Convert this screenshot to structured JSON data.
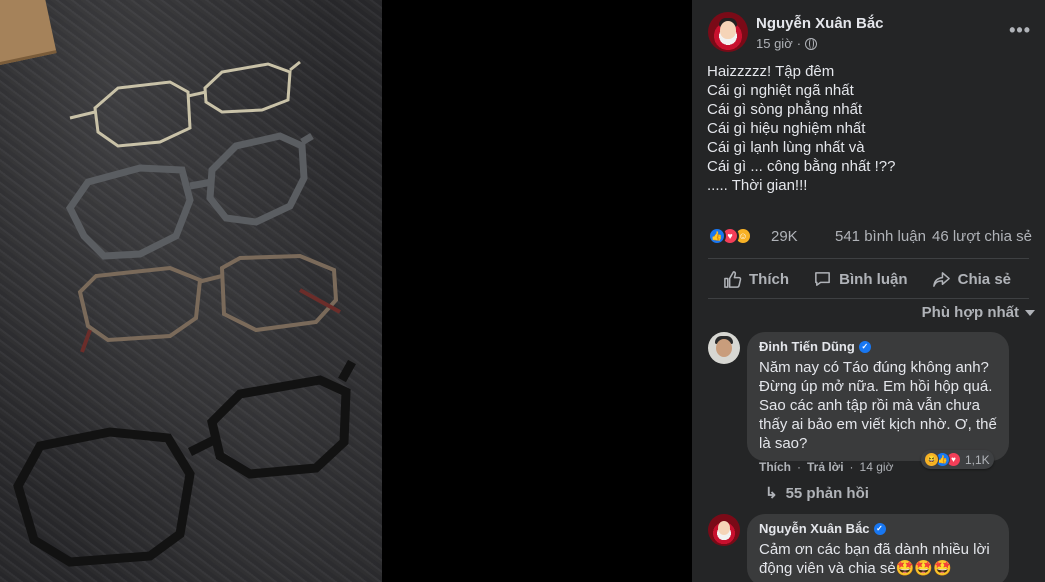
{
  "post": {
    "author": "Nguyễn Xuân Bắc",
    "time": "15 giờ",
    "privacy_icon": "globe-icon",
    "text": "Haizzzzz! Tập đêm\nCái gì nghiệt ngã nhất\nCái gì sòng phẳng nhất\nCái gì hiệu nghiệm nhất\nCái gì lạnh lùng nhất và\nCái gì ... công bằng nhất !??\n..... Thời gian!!!",
    "reaction_count": "29K",
    "comment_count": "541 bình luận",
    "share_count": "46 lượt chia sẻ"
  },
  "actions": {
    "like": "Thích",
    "comment": "Bình luận",
    "share": "Chia sẻ"
  },
  "sort_label": "Phù hợp nhất",
  "comments": [
    {
      "author": "Đinh Tiến Dũng",
      "text": "Năm nay có Táo đúng không anh?\nĐừng úp mở nữa. Em hồi hộp quá.\nSao các anh tập rồi mà vẫn chưa\nthấy ai bảo em viết kịch nhờ. Ơ, thế\nlà sao?",
      "reactions": "1,1K",
      "like": "Thích",
      "reply": "Trả lời",
      "time": "14 giờ",
      "replies": "55 phản hồi"
    },
    {
      "author": "Nguyễn Xuân Bắc",
      "text": "Cảm ơn các bạn đã dành nhiều lời\nđộng viên và chia sẻ🤩🤩🤩"
    }
  ],
  "colors": {
    "panel_bg": "#242526",
    "bubble_bg": "#3a3b3c",
    "like_blue": "#1877f2",
    "love_red": "#f33e58"
  }
}
